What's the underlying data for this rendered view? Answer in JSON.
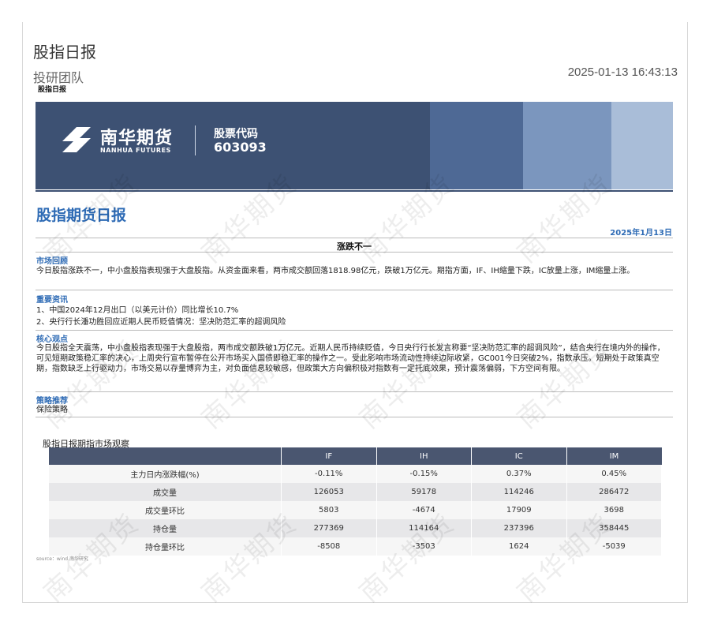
{
  "header": {
    "doc_title": "股指日报",
    "team": "投研团队",
    "sub_label": "股指日报",
    "timestamp": "2025-01-13 16:43:13"
  },
  "banner": {
    "company_cn": "南华期货",
    "company_en": "NANHUA FUTURES",
    "stock_code_label": "股票代码",
    "stock_code": "603093"
  },
  "report": {
    "title": "股指期货日报",
    "date": "2025年1月13日",
    "headline": "涨跌不一"
  },
  "sections": [
    {
      "title": "市场回顾",
      "text": "今日股指涨跌不一，中小盘股指表现强于大盘股指。从资金面来看，两市成交额回落1818.98亿元，跌破1万亿元。期指方面，IF、IH缩量下跌，IC放量上涨，IM缩量上涨。"
    },
    {
      "title": "重要资讯",
      "lines": [
        "1、中国2024年12月出口（以美元计价）同比增长10.7%",
        "2、央行行长潘功胜回应近期人民币贬值情况：坚决防范汇率的超调风险"
      ]
    },
    {
      "title": "核心观点",
      "text": "今日股指全天震荡，中小盘股指表现强于大盘股指，两市成交额跌破1万亿元。近期人民币持续贬值，今日央行行长发言称要“坚决防范汇率的超调风险”，结合央行在境内外的操作，可见短期政策稳汇率的决心，上周央行宣布暂停在公开市场买入国债即稳汇率的操作之一。受此影响市场流动性持续边际收紧，GC001今日突破2%，指数承压。短期处于政策真空期，指数缺乏上行驱动力，市场交易以存量博弈为主，对负面信息较敏感，但政策大方向偏积极对指数有一定托底效果，预计震荡偏弱，下方空间有限。"
    },
    {
      "title": "策略推荐",
      "text": "保险策略"
    }
  ],
  "table": {
    "title": "股指日报期指市场观察",
    "columns": [
      "",
      "IF",
      "IH",
      "IC",
      "IM"
    ],
    "rows": [
      [
        "主力日内涨跌幅(%)",
        "-0.11%",
        "-0.15%",
        "0.37%",
        "0.45%"
      ],
      [
        "成交量",
        "126053",
        "59178",
        "114246",
        "286472"
      ],
      [
        "成交量环比",
        "5803",
        "-4674",
        "17909",
        "3698"
      ],
      [
        "持仓量",
        "277369",
        "114164",
        "237396",
        "358445"
      ],
      [
        "持仓量环比",
        "-8508",
        "-3503",
        "1624",
        "-5039"
      ]
    ],
    "source": "source：wind,南华研究"
  },
  "watermark": "南华期货",
  "colors": {
    "accent": "#2e6bb5",
    "banner": "#3d5173",
    "table_header": "#4a5670"
  }
}
